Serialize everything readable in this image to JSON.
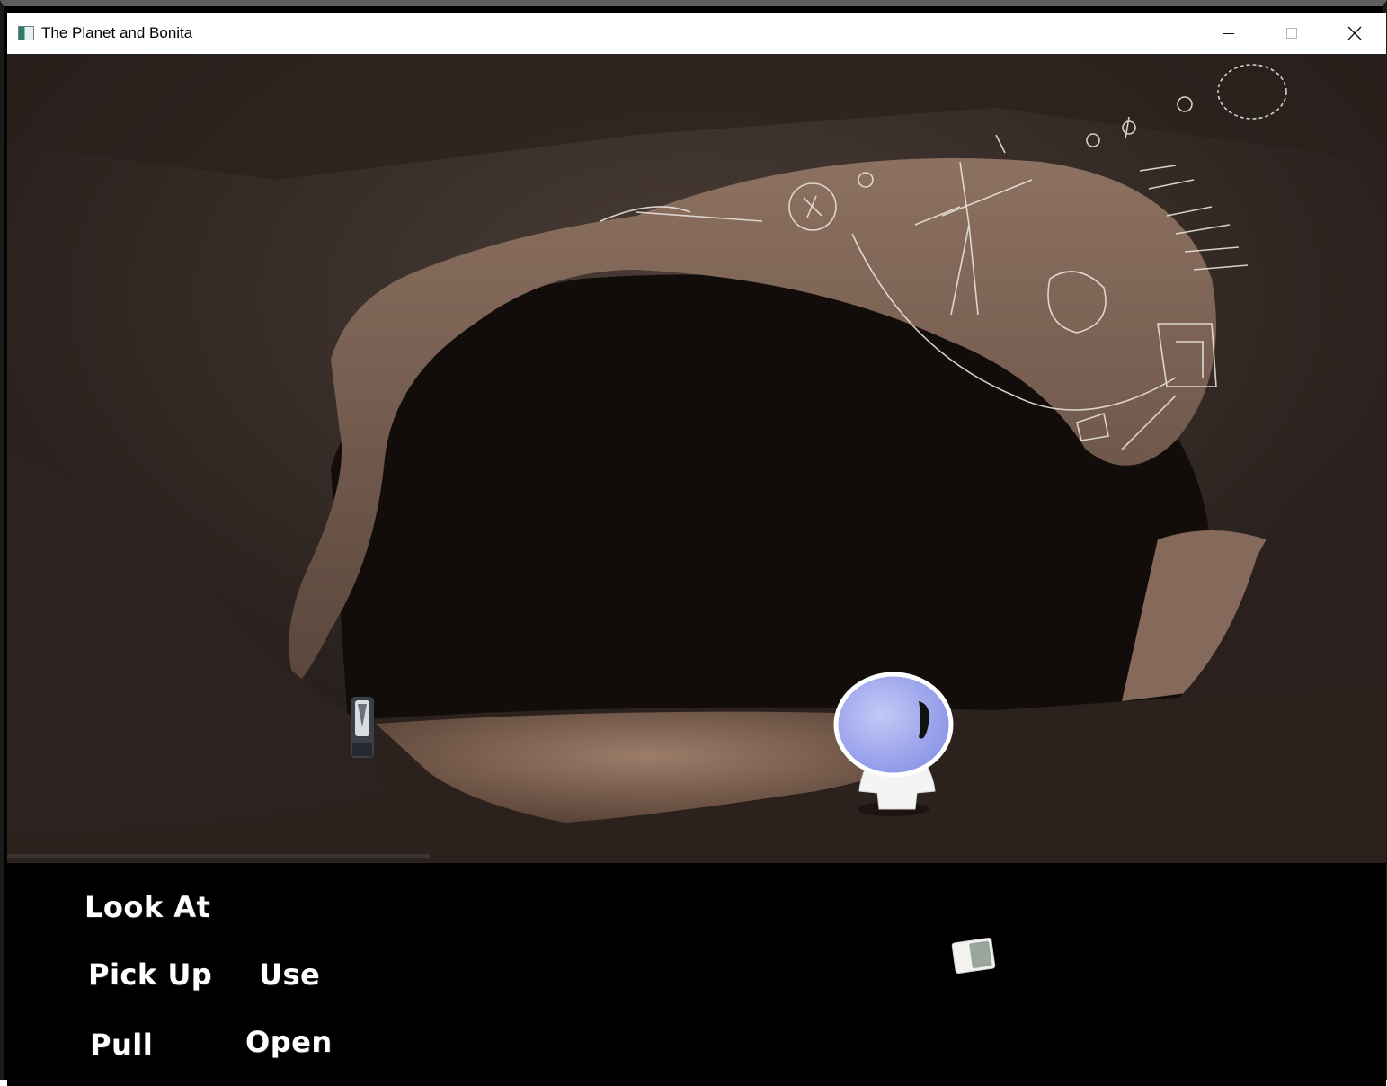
{
  "window": {
    "title": "The Planet and Bonita",
    "icons": {
      "app": "app-window-icon",
      "minimize": "minimize-icon",
      "maximize": "maximize-icon",
      "close": "close-icon"
    }
  },
  "scene": {
    "description_icons": [
      "cave-arch",
      "cave-paintings",
      "flashlight",
      "astronaut-bonita"
    ]
  },
  "verbs": {
    "look_at": "Look At",
    "pick_up": "Pick Up",
    "use": "Use",
    "pull": "Pull",
    "open": "Open"
  },
  "inventory": {
    "items": [
      "note-paper-icon"
    ]
  },
  "colors": {
    "verb_text": "#ffffff",
    "panel_bg": "#000000",
    "helmet": "#a8b3f0"
  }
}
